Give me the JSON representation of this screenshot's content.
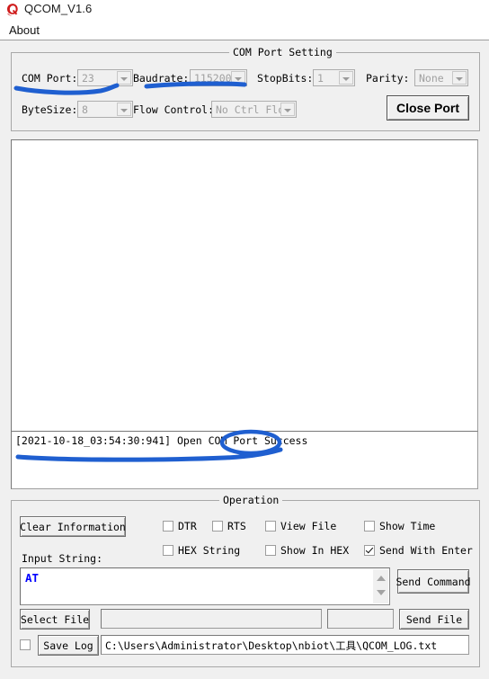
{
  "window": {
    "title": "QCOM_V1.6",
    "icon": "qualcomm-q-logo"
  },
  "menubar": {
    "items": [
      {
        "label": "About"
      }
    ]
  },
  "com_port_setting": {
    "group_title": "COM Port Setting",
    "fields": [
      {
        "label": "COM Port:",
        "value": "23",
        "enabled": false
      },
      {
        "label": "Baudrate:",
        "value": "115200",
        "enabled": false
      },
      {
        "label": "StopBits:",
        "value": "1",
        "enabled": false
      },
      {
        "label": "Parity:",
        "value": "None",
        "enabled": false
      },
      {
        "label": "ByteSize:",
        "value": "8",
        "enabled": false
      },
      {
        "label": "Flow Control:",
        "value": "No Ctrl Flow",
        "enabled": false
      }
    ],
    "close_port_button": "Close Port"
  },
  "output": {
    "text": ""
  },
  "status": {
    "line": "[2021-10-18_03:54:30:941] Open COM Port Success"
  },
  "operation": {
    "group_title": "Operation",
    "clear_button": "Clear Information",
    "input_label": "Input String:",
    "checkboxes": [
      {
        "label": "DTR",
        "checked": false
      },
      {
        "label": "RTS",
        "checked": false
      },
      {
        "label": "View File",
        "checked": false
      },
      {
        "label": "Show Time",
        "checked": false
      },
      {
        "label": "HEX String",
        "checked": false
      },
      {
        "label": "Show In HEX",
        "checked": false
      },
      {
        "label": "Send With Enter",
        "checked": true
      }
    ],
    "input_value": "AT",
    "send_command_button": "Send Command",
    "select_file_button": "Select File",
    "file_path_value": "",
    "file_size_value": "",
    "send_file_button": "Send File",
    "save_log_checked": false,
    "save_log_button": "Save Log",
    "log_path_value": "C:\\Users\\Administrator\\Desktop\\nbiot\\工具\\QCOM_LOG.txt"
  },
  "annotations": {
    "color": "#1f5fd0",
    "marks": [
      {
        "name": "underline-com-port",
        "shape": "stroke"
      },
      {
        "name": "underline-baudrate",
        "shape": "stroke"
      },
      {
        "name": "underline-status-line",
        "shape": "stroke"
      },
      {
        "name": "circle-success",
        "shape": "ellipse"
      }
    ]
  }
}
